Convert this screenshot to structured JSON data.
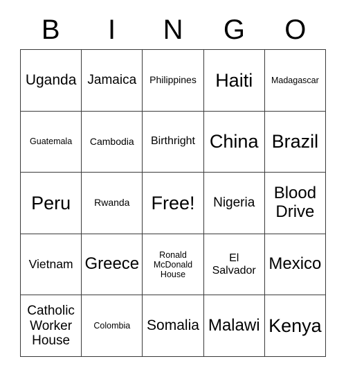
{
  "card": {
    "title": "BINGO",
    "header_letters": [
      "B",
      "I",
      "N",
      "G",
      "O"
    ],
    "columns": 5,
    "rows": 5,
    "free_space": {
      "row": 3,
      "column": 3,
      "label": "Free!"
    },
    "colors": {
      "background": "#ffffff",
      "text": "#000000",
      "grid_line": "#3a3a3a"
    },
    "cells": [
      [
        {
          "text": "Uganda",
          "size": "fs-xl"
        },
        {
          "text": "Jamaica",
          "size": "fs-l"
        },
        {
          "text": "Philippines",
          "size": "fs-s"
        },
        {
          "text": "Haiti",
          "size": "fs-3xl"
        },
        {
          "text": "Madagascar",
          "size": "fs-xs"
        }
      ],
      [
        {
          "text": "Guatemala",
          "size": "fs-xs"
        },
        {
          "text": "Cambodia",
          "size": "fs-s"
        },
        {
          "text": "Birthright",
          "size": "fs-m"
        },
        {
          "text": "China",
          "size": "fs-3xl"
        },
        {
          "text": "Brazil",
          "size": "fs-3xl"
        }
      ],
      [
        {
          "text": "Peru",
          "size": "fs-3xl"
        },
        {
          "text": "Rwanda",
          "size": "fs-s"
        },
        {
          "text": "Free!",
          "size": "fs-3xl"
        },
        {
          "text": "Nigeria",
          "size": "fs-l"
        },
        {
          "text": "Blood\nDrive",
          "size": "fs-xxl"
        }
      ],
      [
        {
          "text": "Vietnam",
          "size": "fs-ml"
        },
        {
          "text": "Greece",
          "size": "fs-xxl"
        },
        {
          "text": "Ronald\nMcDonald\nHouse",
          "size": "fs-xs"
        },
        {
          "text": "El\nSalvador",
          "size": "fs-m"
        },
        {
          "text": "Mexico",
          "size": "fs-xxl"
        }
      ],
      [
        {
          "text": "Catholic\nWorker\nHouse",
          "size": "fs-l"
        },
        {
          "text": "Colombia",
          "size": "fs-xs"
        },
        {
          "text": "Somalia",
          "size": "fs-xl"
        },
        {
          "text": "Malawi",
          "size": "fs-xxl"
        },
        {
          "text": "Kenya",
          "size": "fs-3xl"
        }
      ]
    ]
  }
}
